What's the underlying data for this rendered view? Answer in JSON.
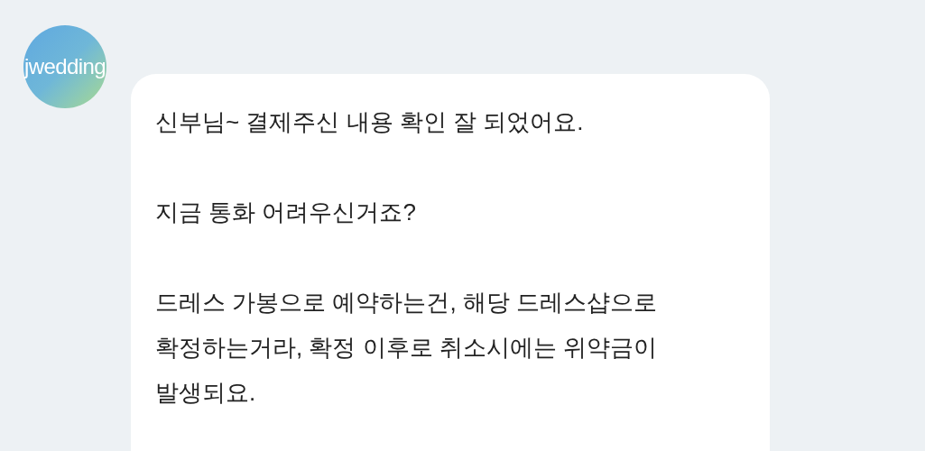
{
  "avatar": {
    "logo_text": "jwedding"
  },
  "message": {
    "paragraphs": [
      {
        "lines": [
          "신부님~ 결제주신 내용 확인 잘 되었어요."
        ]
      },
      {
        "lines": [
          "지금 통화 어려우신거죠?"
        ]
      },
      {
        "lines": [
          "드레스 가봉으로 예약하는건, 해당 드레스샵으로",
          "확정하는거라, 확정 이후로 취소시에는 위약금이",
          "발생되요."
        ]
      }
    ]
  }
}
